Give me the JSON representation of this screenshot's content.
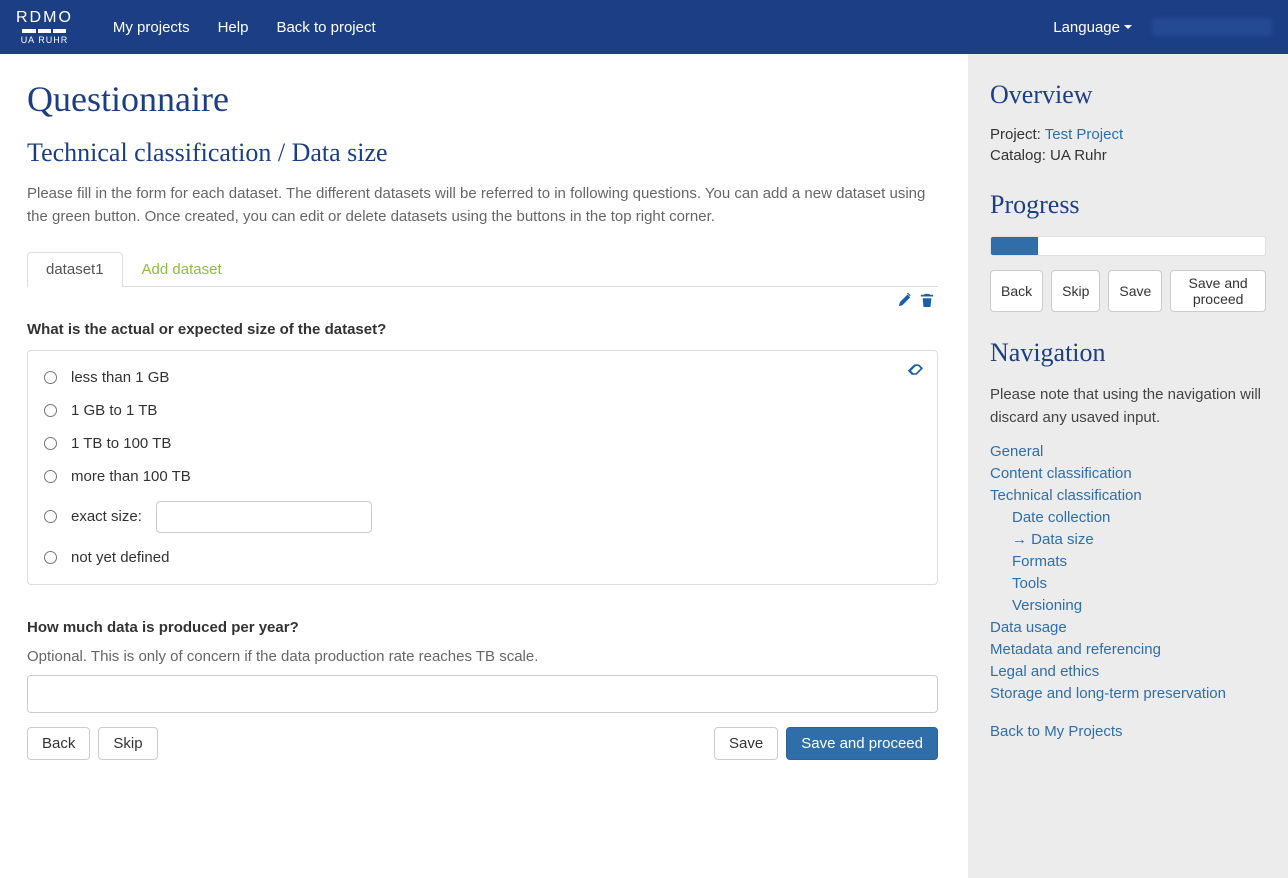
{
  "nav": {
    "brand_top": "RDMO",
    "brand_bot": "UA RUHR",
    "my_projects": "My projects",
    "help": "Help",
    "back_to_project": "Back to project",
    "language": "Language"
  },
  "main": {
    "page_title": "Questionnaire",
    "section_title": "Technical classification / Data size",
    "instructions": "Please fill in the form for each dataset. The different datasets will be referred to in following questions. You can add a new dataset using the green button. Once created, you can edit or delete datasets using the buttons in the top right corner.",
    "tabs": {
      "dataset": "dataset1",
      "add": "Add dataset"
    },
    "q1": {
      "label": "What is the actual or expected size of the dataset?",
      "opt1": "less than 1 GB",
      "opt2": "1 GB to 1 TB",
      "opt3": "1 TB to 100 TB",
      "opt4": "more than 100 TB",
      "opt5": "exact size:",
      "opt6": "not yet defined"
    },
    "q2": {
      "label": "How much data is produced per year?",
      "help": "Optional. This is only of concern if the data production rate reaches TB scale."
    },
    "buttons": {
      "back": "Back",
      "skip": "Skip",
      "save": "Save",
      "save_proceed": "Save and proceed"
    }
  },
  "sidebar": {
    "overview": {
      "title": "Overview",
      "project_label": "Project: ",
      "project_link": "Test Project",
      "catalog_label": "Catalog: ",
      "catalog_value": "UA Ruhr"
    },
    "progress": {
      "title": "Progress",
      "percent": 17,
      "back": "Back",
      "skip": "Skip",
      "save": "Save",
      "save_proceed": "Save and proceed"
    },
    "navigation": {
      "title": "Navigation",
      "note": "Please note that using the navigation will discard any usaved input.",
      "items": [
        {
          "label": "General",
          "sub": false
        },
        {
          "label": "Content classification",
          "sub": false
        },
        {
          "label": "Technical classification",
          "sub": false
        },
        {
          "label": "Date collection",
          "sub": true
        },
        {
          "label": "Data size",
          "sub": true,
          "current": true
        },
        {
          "label": "Formats",
          "sub": true
        },
        {
          "label": "Tools",
          "sub": true
        },
        {
          "label": "Versioning",
          "sub": true
        },
        {
          "label": "Data usage",
          "sub": false
        },
        {
          "label": "Metadata and referencing",
          "sub": false
        },
        {
          "label": "Legal and ethics",
          "sub": false
        },
        {
          "label": "Storage and long-term preservation",
          "sub": false
        }
      ],
      "back_link": "Back to My Projects"
    }
  }
}
